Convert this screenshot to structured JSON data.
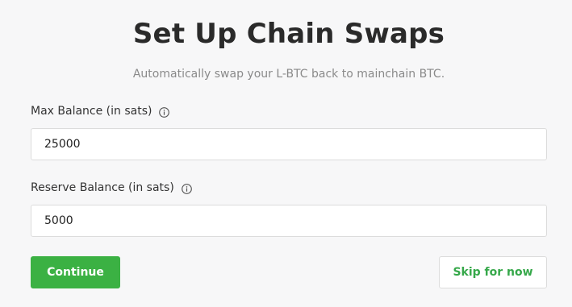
{
  "header": {
    "title": "Set Up Chain Swaps",
    "subtitle": "Automatically swap your L-BTC back to mainchain BTC."
  },
  "form": {
    "max_balance": {
      "label": "Max Balance (in sats)",
      "icon": "info-icon",
      "value": "25000"
    },
    "reserve_balance": {
      "label": "Reserve Balance (in sats)",
      "icon": "info-icon",
      "value": "5000"
    }
  },
  "actions": {
    "continue_label": "Continue",
    "skip_label": "Skip for now"
  },
  "colors": {
    "primary": "#3bb143",
    "link_text": "#36a84a",
    "background": "#f7f7f8"
  }
}
